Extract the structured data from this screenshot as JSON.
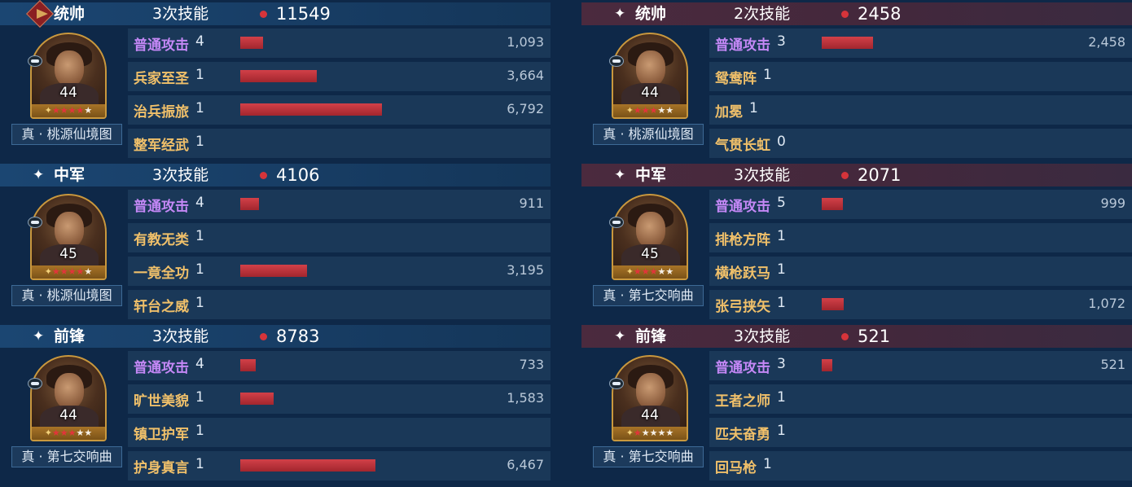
{
  "left": [
    {
      "role": "统帅",
      "skills_label": "3次技能",
      "total": "11549",
      "level": "44",
      "stars": 5,
      "red_stars": 4,
      "caption": "真 · 桃源仙境图",
      "rows": [
        {
          "name": "普通攻击",
          "count": "4",
          "damage": "1,093",
          "value": 1093,
          "basic": true
        },
        {
          "name": "兵家至圣",
          "count": "1",
          "damage": "3,664",
          "value": 3664
        },
        {
          "name": "治兵振旅",
          "count": "1",
          "damage": "6,792",
          "value": 6792
        },
        {
          "name": "整军经武",
          "count": "1",
          "damage": "",
          "value": 0
        }
      ]
    },
    {
      "role": "中军",
      "skills_label": "3次技能",
      "total": "4106",
      "level": "45",
      "stars": 5,
      "red_stars": 4,
      "caption": "真 · 桃源仙境图",
      "rows": [
        {
          "name": "普通攻击",
          "count": "4",
          "damage": "911",
          "value": 911,
          "basic": true
        },
        {
          "name": "有教无类",
          "count": "1",
          "damage": "",
          "value": 0
        },
        {
          "name": "一竟全功",
          "count": "1",
          "damage": "3,195",
          "value": 3195
        },
        {
          "name": "轩台之威",
          "count": "1",
          "damage": "",
          "value": 0
        }
      ]
    },
    {
      "role": "前锋",
      "skills_label": "3次技能",
      "total": "8783",
      "level": "44",
      "stars": 5,
      "red_stars": 3,
      "caption": "真 · 第七交响曲",
      "rows": [
        {
          "name": "普通攻击",
          "count": "4",
          "damage": "733",
          "value": 733,
          "basic": true
        },
        {
          "name": "旷世美貌",
          "count": "1",
          "damage": "1,583",
          "value": 1583
        },
        {
          "name": "镇卫护军",
          "count": "1",
          "damage": "",
          "value": 0
        },
        {
          "name": "护身真言",
          "count": "1",
          "damage": "6,467",
          "value": 6467
        }
      ]
    }
  ],
  "right": [
    {
      "role": "统帅",
      "skills_label": "2次技能",
      "total": "2458",
      "level": "44",
      "stars": 5,
      "red_stars": 3,
      "caption": "真 · 桃源仙境图",
      "rows": [
        {
          "name": "普通攻击",
          "count": "3",
          "damage": "2,458",
          "value": 2458,
          "basic": true
        },
        {
          "name": "鸳鸯阵",
          "count": "1",
          "damage": "",
          "value": 0
        },
        {
          "name": "加冕",
          "count": "1",
          "damage": "",
          "value": 0
        },
        {
          "name": "气贯长虹",
          "count": "0",
          "damage": "",
          "value": 0
        }
      ]
    },
    {
      "role": "中军",
      "skills_label": "3次技能",
      "total": "2071",
      "level": "45",
      "stars": 5,
      "red_stars": 3,
      "caption": "真 · 第七交响曲",
      "rows": [
        {
          "name": "普通攻击",
          "count": "5",
          "damage": "999",
          "value": 999,
          "basic": true
        },
        {
          "name": "排枪方阵",
          "count": "1",
          "damage": "",
          "value": 0
        },
        {
          "name": "横枪跃马",
          "count": "1",
          "damage": "",
          "value": 0
        },
        {
          "name": "张弓挟矢",
          "count": "1",
          "damage": "1,072",
          "value": 1072
        }
      ]
    },
    {
      "role": "前锋",
      "skills_label": "3次技能",
      "total": "521",
      "level": "44",
      "stars": 5,
      "red_stars": 1,
      "caption": "真 · 第七交响曲",
      "rows": [
        {
          "name": "普通攻击",
          "count": "3",
          "damage": "521",
          "value": 521,
          "basic": true
        },
        {
          "name": "王者之师",
          "count": "1",
          "damage": "",
          "value": 0
        },
        {
          "name": "匹夫奋勇",
          "count": "1",
          "damage": "",
          "value": 0
        },
        {
          "name": "回马枪",
          "count": "1",
          "damage": "",
          "value": 0
        }
      ]
    }
  ],
  "bar_max_value": 6792,
  "colors": {
    "bar": "#c8323a",
    "skill_name": "#f0c06a",
    "basic_attack": "#c488f6",
    "dot": "#d6343a"
  },
  "icons": {
    "header_mark": "four-point-star-icon",
    "commander_emblem": "army-flag-icon",
    "portrait_tag": "unit-type-icon"
  }
}
